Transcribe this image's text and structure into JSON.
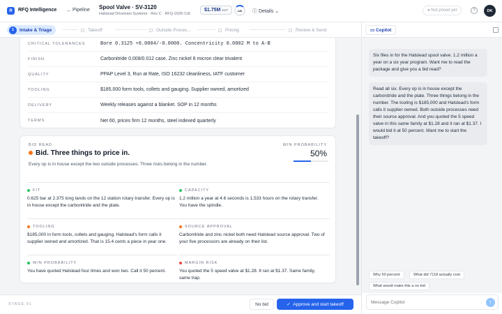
{
  "app": {
    "logo": "R",
    "name": "RFQ Intelligence",
    "back_link": "Pipeline"
  },
  "header": {
    "title": "Spool Valve · SV-3120",
    "subtitle": "Halstead Drivetrain Systems · Rev C · RFQ-2026-118",
    "amount": "$1.75M",
    "amount_unit": "EST",
    "ring_label": "12k",
    "details": "Details",
    "status": "Not priced yet",
    "help": "?",
    "avatar": "DK"
  },
  "steps": [
    {
      "num": "1",
      "label": "Intake & Triage"
    },
    {
      "label": "Takeoff"
    },
    {
      "label": "Outside Proces..."
    },
    {
      "label": "Pricing"
    },
    {
      "label": "Review & Send"
    }
  ],
  "specs": [
    {
      "label": "Critical Tolerances",
      "value": "Bore 0.3125 +0.0004/-0.0000. Concentricity 0.0002 M to A-B"
    },
    {
      "label": "Finish",
      "value": "Carbonitride 0.008/0.012 case. Zinc nickel 8 micron clear trivalent"
    },
    {
      "label": "Quality",
      "value": "PPAP Level 3, Run at Rate, ISO 16232 cleanliness, IATF customer"
    },
    {
      "label": "Tooling",
      "value": "$185,000 form tools, collets and gauging. Supplier owned, amortized"
    },
    {
      "label": "Delivery",
      "value": "Weekly releases against a blanket. SOP in 12 months"
    },
    {
      "label": "Terms",
      "value": "Net 60, prices firm 12 months, steel indexed quarterly"
    }
  ],
  "bid": {
    "label": "BID READ",
    "title": "Bid. Three things to price in.",
    "description": "Every op is in house except the two outside processes. Three risks belong in the number.",
    "win_label": "WIN PROBABILITY",
    "win_value": "50%",
    "win_fraction": 0.5
  },
  "findings": [
    {
      "label": "FIT",
      "color": "#22c55e",
      "text": "0.625 bar at 2.375 long lands on the 12 station rotary transfer. Every op is in house except the carbonitride and the plate."
    },
    {
      "label": "CAPACITY",
      "color": "#22c55e",
      "text": "1.2 million a year at 4.6 seconds is 1,533 hours on the rotary transfer. You have the spindle."
    },
    {
      "label": "TOOLING",
      "color": "#f97316",
      "text": "$185,000 in form tools, collets and gauging. Halstead's form calls it supplier owned and amortized. That is 15.4 cents a piece in year one."
    },
    {
      "label": "SOURCE APPROVAL",
      "color": "#f97316",
      "text": "Carbonitride and zinc nickel both need Halstead source approval. Two of your five processors are already on their list."
    },
    {
      "label": "WIN PROBABILITY",
      "color": "#22c55e",
      "text": "You have quoted Halstead four times and won two. Call it 50 percent."
    },
    {
      "label": "MARGIN RISK",
      "color": "#ef4444",
      "text": "You quoted the 5 speed valve at $1.28. It ran at $1.37. Same family, same trap."
    }
  ],
  "footer": {
    "stage": "STAGE 01",
    "no_bid": "No bid",
    "approve": "Approve and start takeoff"
  },
  "copilot": {
    "tab": "Copilot",
    "messages": [
      "Six files in for the Halstead spool valve. 1.2 million a year on a six year program. Want me to read the package and give you a bid read?",
      "Read all six. Every op is in house except the carbonitride and the plate. Three things belong in the number. The tooling is $185,000 and Halstead's form calls it supplier owned. Both outside processes need their source approval. And you quoted the 5 speed valve in this same family at $1.28 and it ran at $1.37. I would bid it at 50 percent. Want me to start the takeoff?"
    ],
    "chips": [
      "Why 50 percent",
      "What did 7118 actually cost",
      "What would make this a no bid"
    ],
    "placeholder": "Message Copilot"
  }
}
